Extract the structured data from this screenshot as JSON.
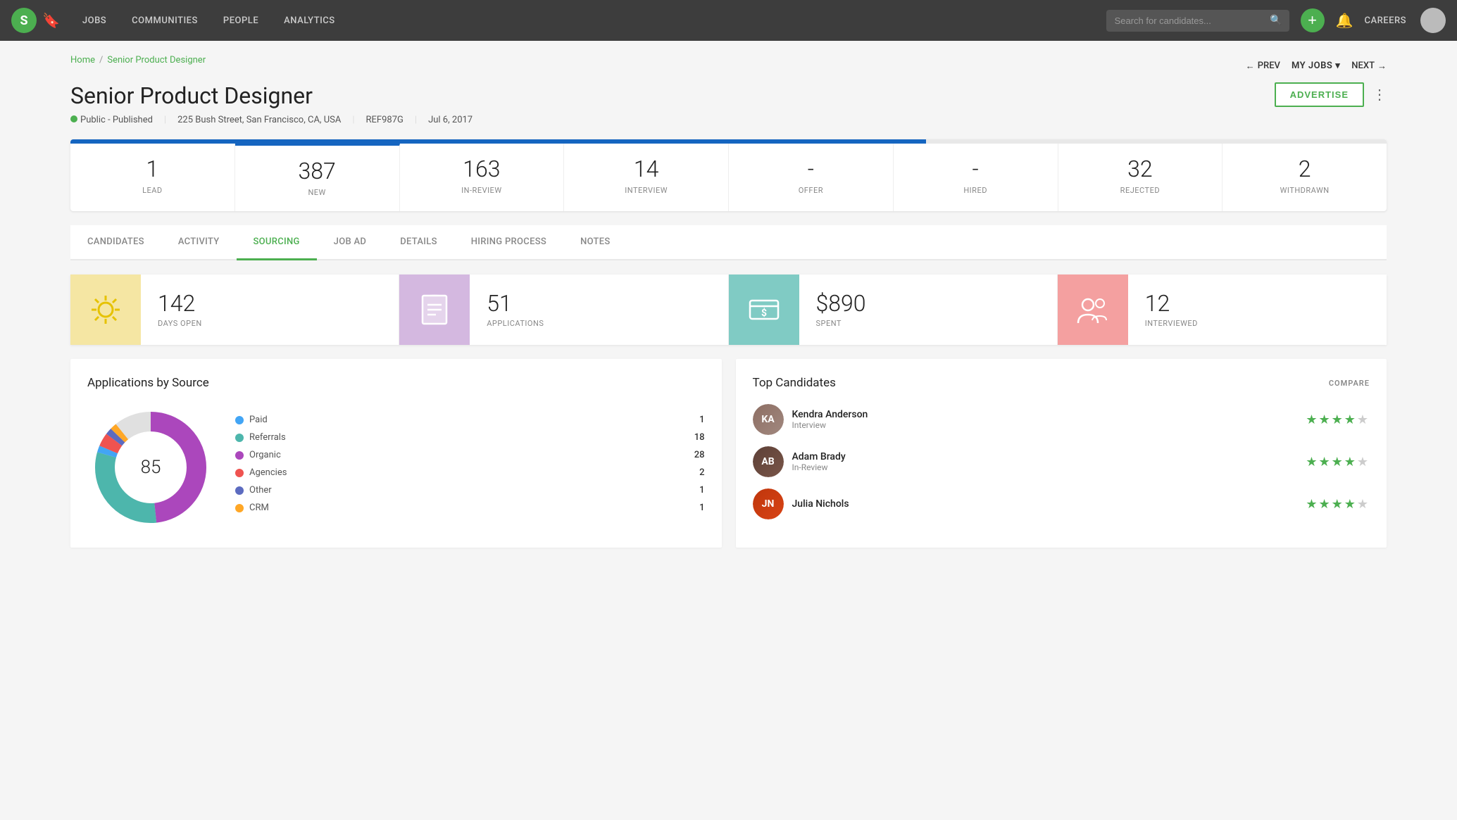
{
  "nav": {
    "logo": "S",
    "items": [
      "JOBS",
      "COMMUNITIES",
      "PEOPLE",
      "ANALYTICS"
    ],
    "search_placeholder": "Search for candidates...",
    "add_button": "+",
    "careers_label": "CAREERS"
  },
  "breadcrumb": {
    "home": "Home",
    "separator": "/",
    "current": "Senior Product Designer"
  },
  "header": {
    "title": "Senior Product Designer",
    "prev_label": "PREV",
    "my_jobs_label": "MY JOBS",
    "next_label": "NEXT",
    "advertise_label": "ADVERTISE"
  },
  "job_meta": {
    "status": "Public - Published",
    "address": "225 Bush Street, San Francisco, CA, USA",
    "ref": "REF987G",
    "date": "Jul 6, 2017"
  },
  "stats": [
    {
      "value": "1",
      "label": "LEAD"
    },
    {
      "value": "387",
      "label": "NEW"
    },
    {
      "value": "163",
      "label": "IN-REVIEW"
    },
    {
      "value": "14",
      "label": "INTERVIEW"
    },
    {
      "value": "-",
      "label": "OFFER"
    },
    {
      "value": "-",
      "label": "HIRED"
    },
    {
      "value": "32",
      "label": "REJECTED"
    },
    {
      "value": "2",
      "label": "WITHDRAWN"
    }
  ],
  "tabs": [
    "CANDIDATES",
    "ACTIVITY",
    "SOURCING",
    "JOB AD",
    "DETAILS",
    "HIRING PROCESS",
    "NOTES"
  ],
  "active_tab": "SOURCING",
  "sourcing_cards": [
    {
      "icon": "☀",
      "icon_color": "yellow",
      "value": "142",
      "label": "DAYS OPEN"
    },
    {
      "icon": "📄",
      "icon_color": "purple",
      "value": "51",
      "label": "APPLICATIONS"
    },
    {
      "icon": "$",
      "icon_color": "teal",
      "value": "$890",
      "label": "SPENT"
    },
    {
      "icon": "👥",
      "icon_color": "pink",
      "value": "12",
      "label": "INTERVIEWED"
    }
  ],
  "applications_by_source": {
    "title": "Applications by Source",
    "total": "85",
    "legend": [
      {
        "label": "Paid",
        "count": "1",
        "color": "#42a5f5"
      },
      {
        "label": "Referrals",
        "count": "18",
        "color": "#4db6ac"
      },
      {
        "label": "Organic",
        "count": "28",
        "color": "#ab47bc"
      },
      {
        "label": "Agencies",
        "count": "2",
        "color": "#ef5350"
      },
      {
        "label": "Other",
        "count": "1",
        "color": "#5c6bc0"
      },
      {
        "label": "CRM",
        "count": "1",
        "color": "#ffa726"
      }
    ]
  },
  "top_candidates": {
    "title": "Top Candidates",
    "compare_label": "COMPARE",
    "candidates": [
      {
        "name": "Kendra Anderson",
        "stage": "Interview",
        "stars": 4.5,
        "initials": "KA"
      },
      {
        "name": "Adam Brady",
        "stage": "In-Review",
        "stars": 4,
        "initials": "AB"
      },
      {
        "name": "Julia Nichols",
        "stage": "",
        "stars": 4,
        "initials": "JN"
      }
    ]
  }
}
